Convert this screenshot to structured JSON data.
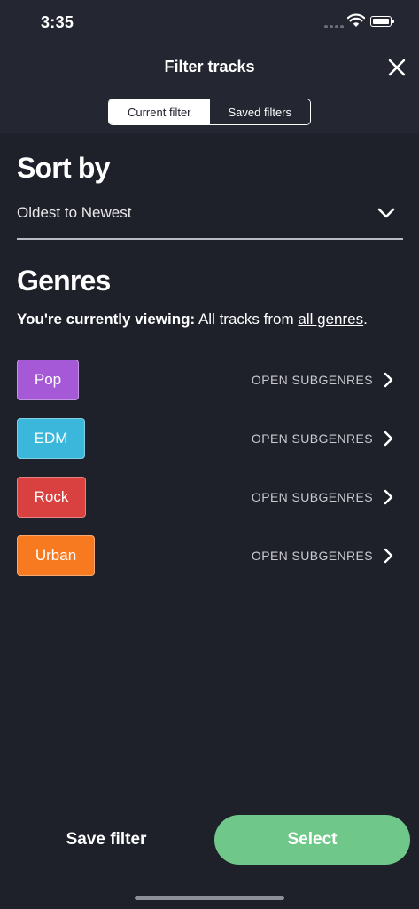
{
  "status_bar": {
    "time": "3:35"
  },
  "header": {
    "title": "Filter tracks",
    "tabs": [
      {
        "label": "Current filter",
        "active": true
      },
      {
        "label": "Saved filters",
        "active": false
      }
    ]
  },
  "sort": {
    "title": "Sort by",
    "selected": "Oldest to Newest"
  },
  "genres": {
    "title": "Genres",
    "viewing_prefix": "You're currently viewing:",
    "viewing_middle": "All tracks from",
    "viewing_link": "all genres",
    "viewing_suffix": ".",
    "items": [
      {
        "label": "Pop",
        "color": "#a659d6",
        "action": "OPEN SUBGENRES"
      },
      {
        "label": "EDM",
        "color": "#3bb7db",
        "action": "OPEN SUBGENRES"
      },
      {
        "label": "Rock",
        "color": "#d94040",
        "action": "OPEN SUBGENRES"
      },
      {
        "label": "Urban",
        "color": "#f77a21",
        "action": "OPEN SUBGENRES"
      }
    ]
  },
  "footer": {
    "save_label": "Save filter",
    "select_label": "Select",
    "select_color": "#6fc88a"
  }
}
